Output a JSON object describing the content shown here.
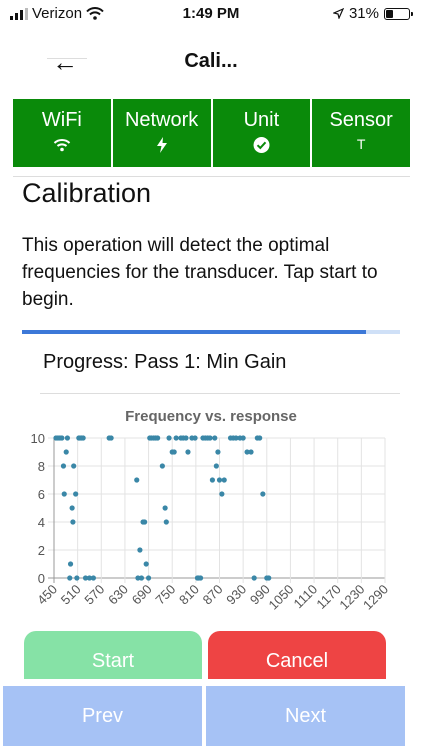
{
  "status_bar": {
    "carrier": "Verizon",
    "time": "1:49 PM",
    "battery": "31%",
    "battery_level": 0.31
  },
  "nav": {
    "back_label": "←",
    "title": "Cali..."
  },
  "tabs": [
    {
      "label": "WiFi",
      "icon": "wifi-icon"
    },
    {
      "label": "Network",
      "icon": "bolt-icon"
    },
    {
      "label": "Unit",
      "icon": "check-circle-icon"
    },
    {
      "label": "Sensor",
      "icon_text": "T"
    }
  ],
  "calibration": {
    "title": "Calibration",
    "description": "This operation will detect the optimal frequencies for the transducer. Tap start to begin.",
    "progress": 0.91,
    "progress_text": "Progress: Pass 1: Min Gain"
  },
  "chart_data": {
    "type": "scatter",
    "title": "Frequency vs. response",
    "xlim": [
      450,
      1290
    ],
    "ylim": [
      0,
      10
    ],
    "x_ticks": [
      450,
      510,
      570,
      630,
      690,
      750,
      810,
      870,
      930,
      990,
      1050,
      1110,
      1170,
      1230,
      1290
    ],
    "y_ticks": [
      0,
      2,
      4,
      6,
      8,
      10
    ],
    "grid": true,
    "point_color": "#3a87a7",
    "points": [
      [
        455,
        10
      ],
      [
        460,
        10
      ],
      [
        465,
        10
      ],
      [
        470,
        10
      ],
      [
        474,
        8
      ],
      [
        476,
        6
      ],
      [
        481,
        9
      ],
      [
        484,
        10
      ],
      [
        490,
        0
      ],
      [
        492,
        1
      ],
      [
        496,
        5
      ],
      [
        498,
        4
      ],
      [
        500,
        8
      ],
      [
        505,
        6
      ],
      [
        508,
        0
      ],
      [
        513,
        10
      ],
      [
        516,
        10
      ],
      [
        520,
        10
      ],
      [
        524,
        10
      ],
      [
        530,
        0
      ],
      [
        540,
        0
      ],
      [
        550,
        0
      ],
      [
        590,
        10
      ],
      [
        595,
        10
      ],
      [
        660,
        7
      ],
      [
        663,
        0
      ],
      [
        668,
        2
      ],
      [
        672,
        0
      ],
      [
        676,
        4
      ],
      [
        680,
        4
      ],
      [
        684,
        1
      ],
      [
        690,
        0
      ],
      [
        693,
        10
      ],
      [
        697,
        10
      ],
      [
        703,
        10
      ],
      [
        708,
        10
      ],
      [
        713,
        10
      ],
      [
        725,
        8
      ],
      [
        732,
        5
      ],
      [
        735,
        4
      ],
      [
        742,
        10
      ],
      [
        750,
        9
      ],
      [
        755,
        9
      ],
      [
        760,
        10
      ],
      [
        772,
        10
      ],
      [
        778,
        10
      ],
      [
        785,
        10
      ],
      [
        790,
        9
      ],
      [
        800,
        10
      ],
      [
        808,
        10
      ],
      [
        814,
        0
      ],
      [
        817,
        0
      ],
      [
        822,
        0
      ],
      [
        828,
        10
      ],
      [
        834,
        10
      ],
      [
        840,
        10
      ],
      [
        846,
        10
      ],
      [
        852,
        7
      ],
      [
        858,
        10
      ],
      [
        862,
        8
      ],
      [
        866,
        9
      ],
      [
        870,
        7
      ],
      [
        876,
        6
      ],
      [
        882,
        7
      ],
      [
        898,
        10
      ],
      [
        905,
        10
      ],
      [
        912,
        10
      ],
      [
        922,
        10
      ],
      [
        930,
        10
      ],
      [
        940,
        9
      ],
      [
        950,
        9
      ],
      [
        958,
        0
      ],
      [
        966,
        10
      ],
      [
        972,
        10
      ],
      [
        980,
        6
      ],
      [
        990,
        0
      ],
      [
        995,
        0
      ]
    ]
  },
  "buttons": {
    "start": "Start",
    "cancel": "Cancel",
    "prev": "Prev",
    "next": "Next"
  }
}
